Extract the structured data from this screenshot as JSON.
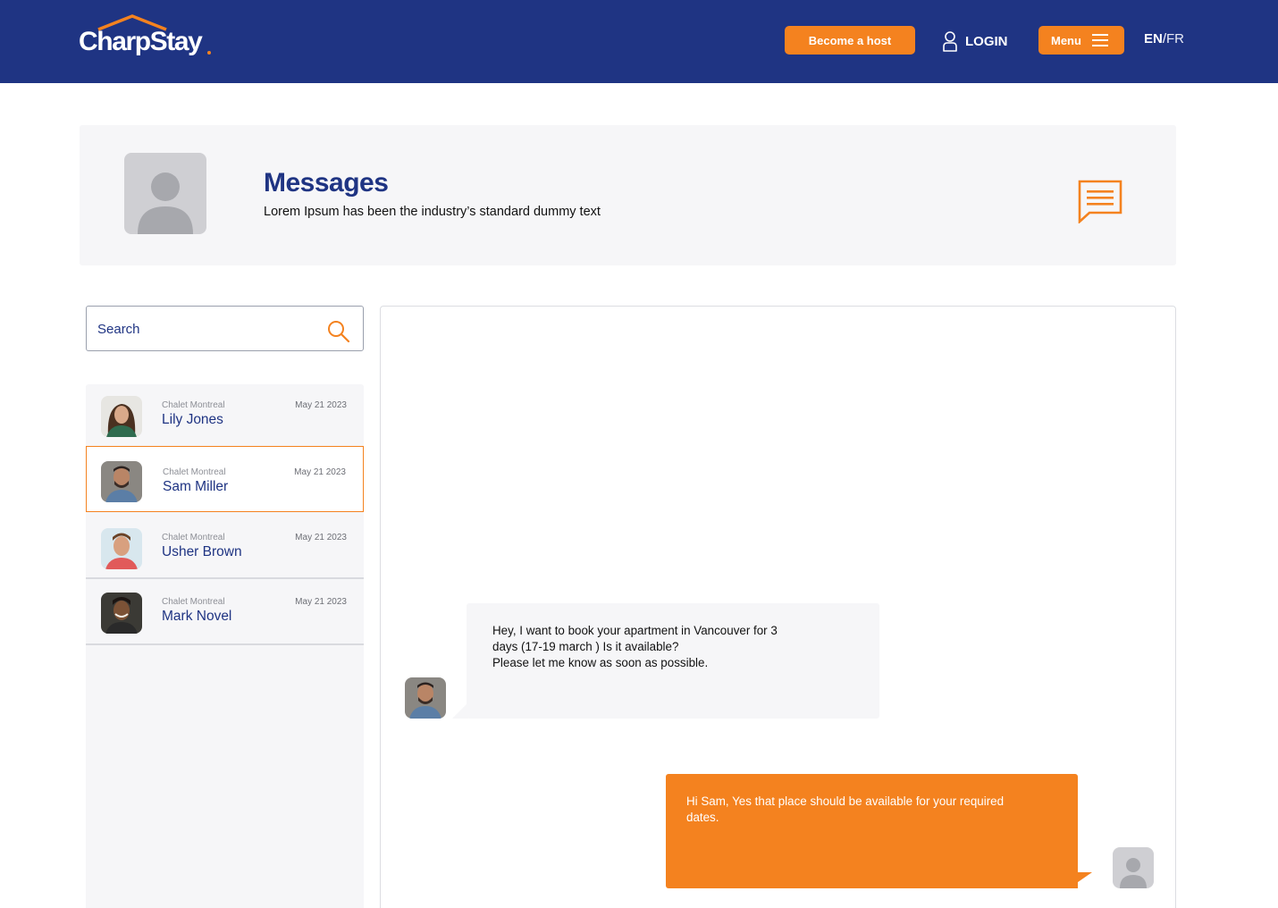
{
  "header": {
    "logo_text": "CharpStay",
    "become_host_label": "Become a host",
    "login_label": "LOGIN",
    "menu_label": "Menu",
    "lang_active": "EN",
    "lang_separator": "/",
    "lang_other": "FR",
    "icons": {
      "login": "user-icon",
      "menu": "hamburger-icon",
      "logo": "house-roof-icon"
    }
  },
  "banner": {
    "title": "Messages",
    "subtitle": "Lorem Ipsum has been the industry’s standard dummy text",
    "icon": "chat-bubble-icon"
  },
  "search": {
    "placeholder": "Search",
    "icon": "search-icon"
  },
  "conversations": [
    {
      "place": "Chalet Montreal",
      "name": "Lily Jones",
      "date": "May 21 2023",
      "active": false
    },
    {
      "place": "Chalet Montreal",
      "name": "Sam Miller",
      "date": "May 21 2023",
      "active": true
    },
    {
      "place": "Chalet Montreal",
      "name": "Usher Brown",
      "date": "May 21 2023",
      "active": false
    },
    {
      "place": "Chalet Montreal",
      "name": "Mark Novel",
      "date": "May 21 2023",
      "active": false
    }
  ],
  "chat": {
    "incoming": {
      "lines": [
        "Hey, I want to book your apartment in Vancouver for 3",
        "days (17-19  march ) Is it available?",
        "Please let me know as soon as possible."
      ]
    },
    "outgoing": {
      "text": "Hi Sam, Yes that place should be available for your required dates."
    }
  },
  "colors": {
    "brand_navy": "#1f3483",
    "accent_orange": "#f4821f",
    "panel_gray": "#f6f6f8"
  }
}
